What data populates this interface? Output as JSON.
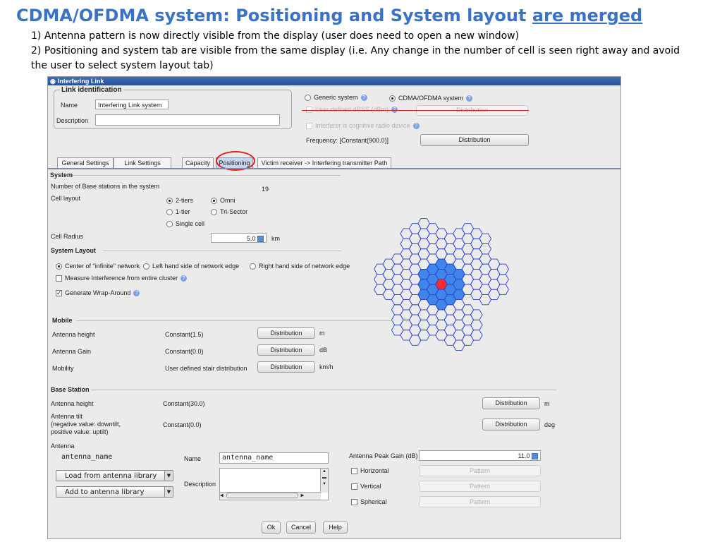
{
  "slide": {
    "title_main": "CDMA/OFDMA system: Positioning and System layout ",
    "title_underlined": "are merged",
    "bullet1": "1) Antenna pattern is now directly visible from the display (user does need to open a new window)",
    "bullet2": "2) Positioning and system tab are visible from the same display (i.e. Any change in the number of cell is seen right away and avoid the user to select system layout tab)"
  },
  "window": {
    "title": "Interfering Link",
    "link_identification": {
      "heading": "Link identification",
      "name_label": "Name",
      "name_value": "Interfering Link system",
      "description_label": "Description",
      "description_value": ""
    },
    "system_type": {
      "generic_label": "Generic system",
      "cdma_label": "CDMA/OFDMA system",
      "selected": "CDMA/OFDMA system",
      "drss_label": "User defined dRSS (dBm)",
      "drss_button": "Distribution",
      "cognitive_label": "Interferer is cognitive radio device",
      "frequency_label": "Frequency: [Constant(900.0)]",
      "frequency_button": "Distribution"
    },
    "tabs": [
      "General Settings",
      "Link Settings",
      "Capacity",
      "Positioning",
      "Victim receiver -> Interfering transmitter Path"
    ],
    "active_tab": "Positioning",
    "system": {
      "heading": "System",
      "num_bs_label": "Number of Base stations in the system",
      "num_bs_value": "19",
      "cell_layout_label": "Cell layout",
      "tiers": [
        "2-tiers",
        "1-tier",
        "Single cell"
      ],
      "tiers_selected": "2-tiers",
      "sector": [
        "Omni",
        "Tri-Sector"
      ],
      "sector_selected": "Omni",
      "cell_radius_label": "Cell Radius",
      "cell_radius_value": "5.0",
      "cell_radius_unit": "km"
    },
    "system_layout": {
      "heading": "System Layout",
      "options": [
        "Center of \"infinite\" network",
        "Left hand side of network edge",
        "Right hand side of network edge"
      ],
      "selected": "Center of \"infinite\" network",
      "measure_label": "Measure Interference from entire cluster",
      "measure_checked": false,
      "wrap_label": "Generate Wrap-Around",
      "wrap_checked": true
    },
    "mobile": {
      "heading": "Mobile",
      "rows": [
        {
          "label": "Antenna height",
          "value": "Constant(1.5)",
          "button": "Distribution",
          "unit": "m"
        },
        {
          "label": "Antenna Gain",
          "value": "Constant(0.0)",
          "button": "Distribution",
          "unit": "dB"
        },
        {
          "label": "Mobility",
          "value": "User defined stair distribution",
          "button": "Distribution",
          "unit": "km/h"
        }
      ]
    },
    "base_station": {
      "heading": "Base Station",
      "height_label": "Antenna height",
      "height_value": "Constant(30.0)",
      "height_button": "Distribution",
      "height_unit": "m",
      "tilt_label_1": "Antenna tilt",
      "tilt_label_2": "(negative value: downtilt,",
      "tilt_label_3": "positive value: uptilt)",
      "tilt_value": "Constant(0.0)",
      "tilt_button": "Distribution",
      "tilt_unit": "deg",
      "antenna_label": "Antenna",
      "antenna_name_display": "antenna_name",
      "name_label": "Name",
      "name_value": "antenna_name",
      "description_label": "Description",
      "load_button": "Load from antenna library",
      "add_button": "Add to antenna library",
      "peak_gain_label": "Antenna Peak Gain (dB)",
      "peak_gain_value": "11.0",
      "patterns": [
        {
          "label": "Horizontal",
          "button": "Pattern"
        },
        {
          "label": "Vertical",
          "button": "Pattern"
        },
        {
          "label": "Spherical",
          "button": "Pattern"
        }
      ]
    },
    "footer": {
      "ok": "Ok",
      "cancel": "Cancel",
      "help": "Help"
    },
    "colors": {
      "highlight_ring": "#e02020",
      "center_cell": "#ff2a2a",
      "tier_cells": "#3f86e8",
      "hex_outline": "#2a3fd1"
    }
  }
}
